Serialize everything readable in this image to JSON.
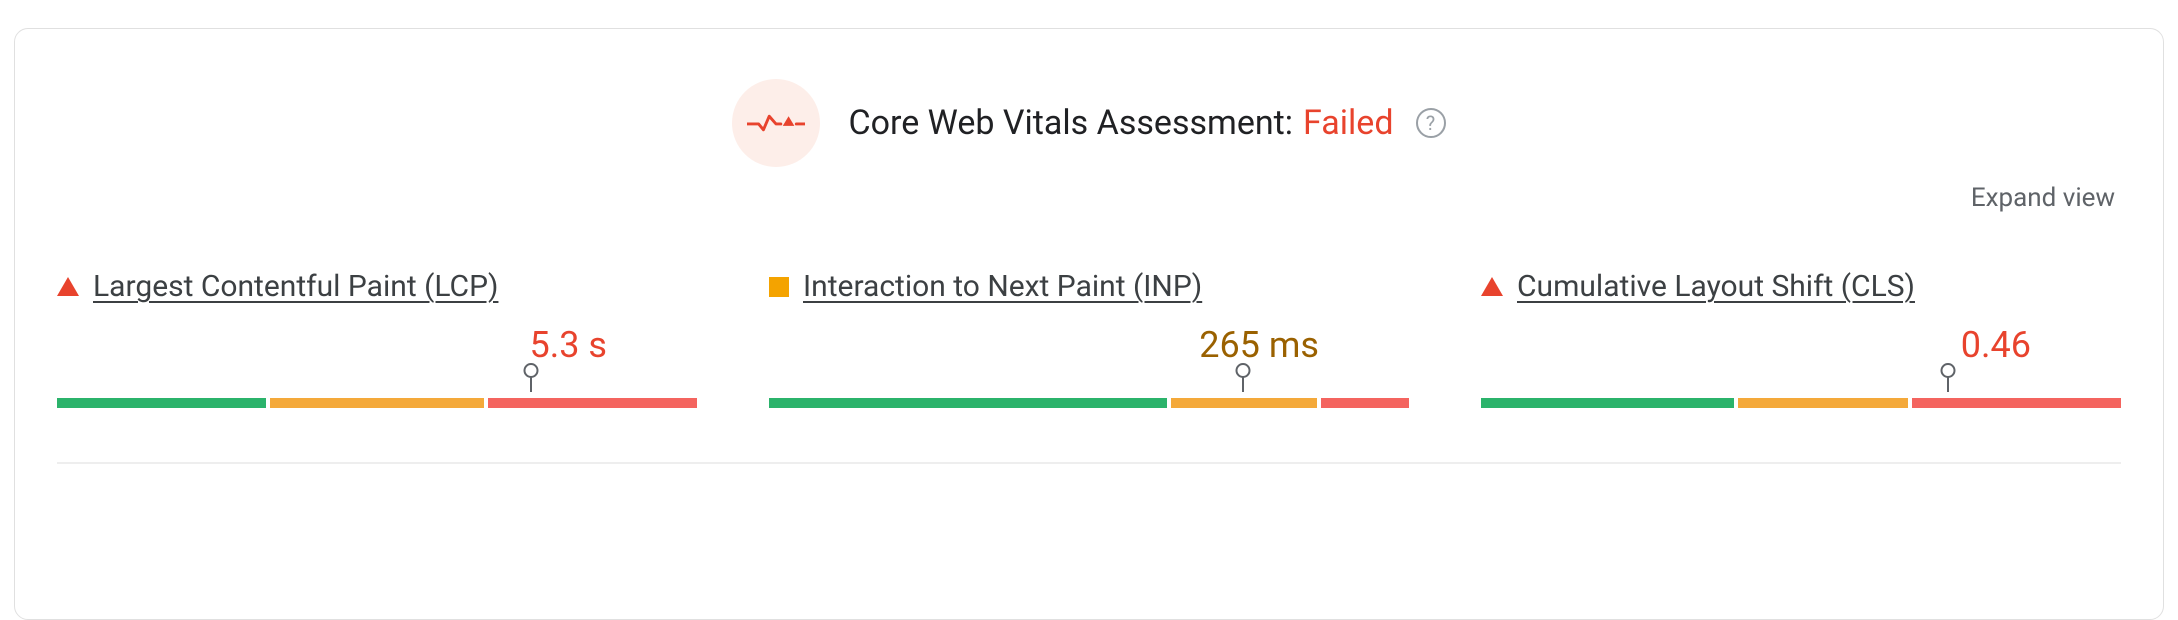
{
  "header": {
    "title_prefix": "Core Web Vitals Assessment:",
    "status": "Failed"
  },
  "controls": {
    "expand_label": "Expand view",
    "help_glyph": "?"
  },
  "colors": {
    "fail": "#e8432d",
    "warn": "#f4a300",
    "good": "#2bb36b",
    "bar_red": "#f4645f",
    "bar_amber": "#f4a93a",
    "bar_green": "#2bb36b"
  },
  "metrics": [
    {
      "id": "lcp",
      "label": "Largest Contentful Paint (LCP)",
      "value_display": "5.3 s",
      "status": "fail",
      "gauge": {
        "green_pct": 33,
        "amber_pct": 34,
        "red_pct": 33,
        "marker_pct": 74
      }
    },
    {
      "id": "inp",
      "label": "Interaction to Next Paint (INP)",
      "value_display": "265 ms",
      "status": "warn",
      "gauge": {
        "green_pct": 63,
        "amber_pct": 23,
        "red_pct": 14,
        "marker_pct": 74
      }
    },
    {
      "id": "cls",
      "label": "Cumulative Layout Shift (CLS)",
      "value_display": "0.46",
      "status": "fail",
      "gauge": {
        "green_pct": 40,
        "amber_pct": 27,
        "red_pct": 33,
        "marker_pct": 73
      }
    }
  ]
}
